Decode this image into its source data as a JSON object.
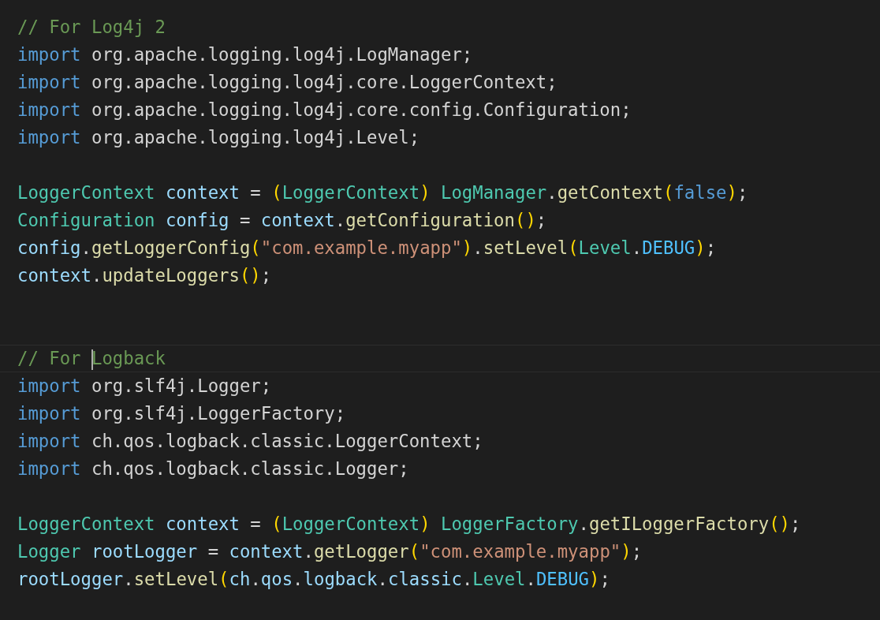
{
  "editor": {
    "lines": [
      {
        "current": false,
        "tokens": [
          {
            "kind": "comment",
            "text": "// For Log4j 2"
          }
        ]
      },
      {
        "current": false,
        "tokens": [
          {
            "kind": "keyword",
            "text": "import"
          },
          {
            "kind": "plain",
            "text": " org.apache.logging.log4j.LogManager;"
          }
        ]
      },
      {
        "current": false,
        "tokens": [
          {
            "kind": "keyword",
            "text": "import"
          },
          {
            "kind": "plain",
            "text": " org.apache.logging.log4j.core.LoggerContext;"
          }
        ]
      },
      {
        "current": false,
        "tokens": [
          {
            "kind": "keyword",
            "text": "import"
          },
          {
            "kind": "plain",
            "text": " org.apache.logging.log4j.core.config.Configuration;"
          }
        ]
      },
      {
        "current": false,
        "tokens": [
          {
            "kind": "keyword",
            "text": "import"
          },
          {
            "kind": "plain",
            "text": " org.apache.logging.log4j.Level;"
          }
        ]
      },
      {
        "current": false
      },
      {
        "current": false,
        "tokens": [
          {
            "kind": "type",
            "text": "LoggerContext "
          },
          {
            "kind": "variable",
            "text": "context"
          },
          {
            "kind": "plain",
            "text": " = "
          },
          {
            "kind": "bracket",
            "text": "("
          },
          {
            "kind": "type",
            "text": "LoggerContext"
          },
          {
            "kind": "bracket",
            "text": ") "
          },
          {
            "kind": "type",
            "text": "LogManager"
          },
          {
            "kind": "plain",
            "text": "."
          },
          {
            "kind": "function",
            "text": "getContext"
          },
          {
            "kind": "bracket",
            "text": "("
          },
          {
            "kind": "keyword",
            "text": "false"
          },
          {
            "kind": "bracket",
            "text": ")"
          },
          {
            "kind": "plain",
            "text": ";"
          }
        ]
      },
      {
        "current": false,
        "tokens": [
          {
            "kind": "type",
            "text": "Configuration "
          },
          {
            "kind": "variable",
            "text": "config"
          },
          {
            "kind": "plain",
            "text": " = "
          },
          {
            "kind": "variable",
            "text": "context"
          },
          {
            "kind": "plain",
            "text": "."
          },
          {
            "kind": "function",
            "text": "getConfiguration"
          },
          {
            "kind": "bracket",
            "text": "()"
          },
          {
            "kind": "plain",
            "text": ";"
          }
        ]
      },
      {
        "current": false,
        "tokens": [
          {
            "kind": "variable",
            "text": "config"
          },
          {
            "kind": "plain",
            "text": "."
          },
          {
            "kind": "function",
            "text": "getLoggerConfig"
          },
          {
            "kind": "bracket",
            "text": "("
          },
          {
            "kind": "string",
            "text": "\"com.example.myapp\""
          },
          {
            "kind": "bracket",
            "text": ")"
          },
          {
            "kind": "plain",
            "text": "."
          },
          {
            "kind": "function",
            "text": "setLevel"
          },
          {
            "kind": "bracket",
            "text": "("
          },
          {
            "kind": "type",
            "text": "Level"
          },
          {
            "kind": "plain",
            "text": "."
          },
          {
            "kind": "constant",
            "text": "DEBUG"
          },
          {
            "kind": "bracket",
            "text": ")"
          },
          {
            "kind": "plain",
            "text": ";"
          }
        ]
      },
      {
        "current": false,
        "tokens": [
          {
            "kind": "variable",
            "text": "context"
          },
          {
            "kind": "plain",
            "text": "."
          },
          {
            "kind": "function",
            "text": "updateLoggers"
          },
          {
            "kind": "bracket",
            "text": "()"
          },
          {
            "kind": "plain",
            "text": ";"
          }
        ]
      },
      {
        "current": false
      },
      {
        "current": false
      },
      {
        "current": true,
        "tokens": [
          {
            "kind": "comment",
            "text": "// For "
          },
          {
            "kind": "cursor"
          },
          {
            "kind": "comment",
            "text": "Logback"
          }
        ]
      },
      {
        "current": false,
        "tokens": [
          {
            "kind": "keyword",
            "text": "import"
          },
          {
            "kind": "plain",
            "text": " org.slf4j.Logger;"
          }
        ]
      },
      {
        "current": false,
        "tokens": [
          {
            "kind": "keyword",
            "text": "import"
          },
          {
            "kind": "plain",
            "text": " org.slf4j.LoggerFactory;"
          }
        ]
      },
      {
        "current": false,
        "tokens": [
          {
            "kind": "keyword",
            "text": "import"
          },
          {
            "kind": "plain",
            "text": " ch.qos.logback.classic.LoggerContext;"
          }
        ]
      },
      {
        "current": false,
        "tokens": [
          {
            "kind": "keyword",
            "text": "import"
          },
          {
            "kind": "plain",
            "text": " ch.qos.logback.classic.Logger;"
          }
        ]
      },
      {
        "current": false
      },
      {
        "current": false,
        "tokens": [
          {
            "kind": "type",
            "text": "LoggerContext "
          },
          {
            "kind": "variable",
            "text": "context"
          },
          {
            "kind": "plain",
            "text": " = "
          },
          {
            "kind": "bracket",
            "text": "("
          },
          {
            "kind": "type",
            "text": "LoggerContext"
          },
          {
            "kind": "bracket",
            "text": ") "
          },
          {
            "kind": "type",
            "text": "LoggerFactory"
          },
          {
            "kind": "plain",
            "text": "."
          },
          {
            "kind": "function",
            "text": "getILoggerFactory"
          },
          {
            "kind": "bracket",
            "text": "()"
          },
          {
            "kind": "plain",
            "text": ";"
          }
        ]
      },
      {
        "current": false,
        "tokens": [
          {
            "kind": "type",
            "text": "Logger "
          },
          {
            "kind": "variable",
            "text": "rootLogger"
          },
          {
            "kind": "plain",
            "text": " = "
          },
          {
            "kind": "variable",
            "text": "context"
          },
          {
            "kind": "plain",
            "text": "."
          },
          {
            "kind": "function",
            "text": "getLogger"
          },
          {
            "kind": "bracket",
            "text": "("
          },
          {
            "kind": "string",
            "text": "\"com.example.myapp\""
          },
          {
            "kind": "bracket",
            "text": ")"
          },
          {
            "kind": "plain",
            "text": ";"
          }
        ]
      },
      {
        "current": false,
        "tokens": [
          {
            "kind": "variable",
            "text": "rootLogger"
          },
          {
            "kind": "plain",
            "text": "."
          },
          {
            "kind": "function",
            "text": "setLevel"
          },
          {
            "kind": "bracket",
            "text": "("
          },
          {
            "kind": "variable",
            "text": "ch"
          },
          {
            "kind": "plain",
            "text": "."
          },
          {
            "kind": "variable",
            "text": "qos"
          },
          {
            "kind": "plain",
            "text": "."
          },
          {
            "kind": "variable",
            "text": "logback"
          },
          {
            "kind": "plain",
            "text": "."
          },
          {
            "kind": "variable",
            "text": "classic"
          },
          {
            "kind": "plain",
            "text": "."
          },
          {
            "kind": "type",
            "text": "Level"
          },
          {
            "kind": "plain",
            "text": "."
          },
          {
            "kind": "constant",
            "text": "DEBUG"
          },
          {
            "kind": "bracket",
            "text": ")"
          },
          {
            "kind": "plain",
            "text": ";"
          }
        ]
      }
    ]
  }
}
